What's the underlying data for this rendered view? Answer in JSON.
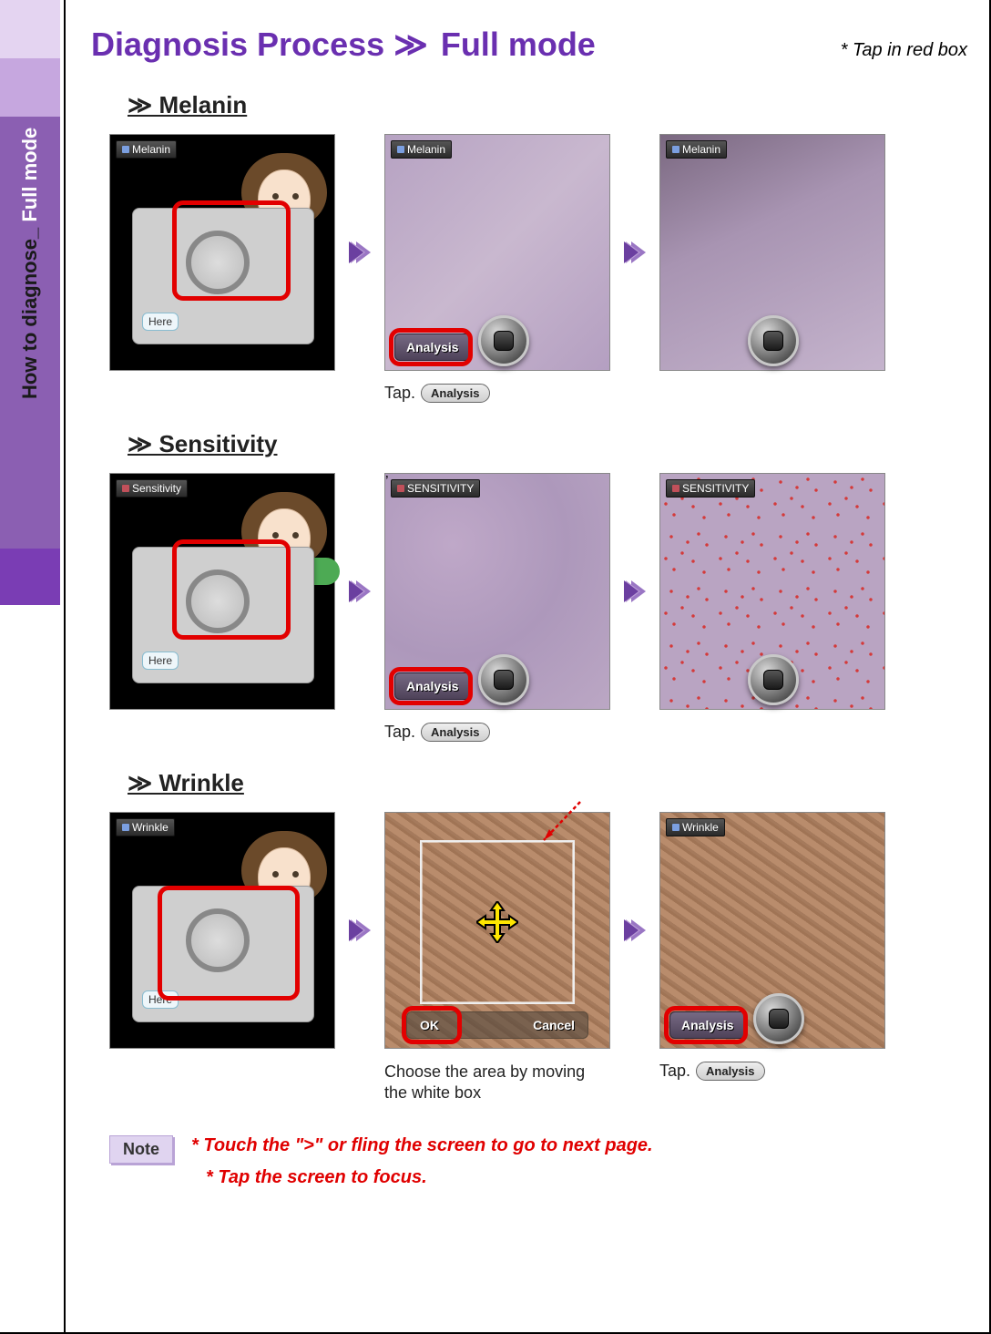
{
  "sidebar": {
    "label_prefix": "How to diagnose_ ",
    "label_suffix": "Full mode"
  },
  "header": {
    "title_a": "Diagnosis Process ",
    "title_sep": "≫",
    "title_b": " Full mode",
    "hint": "* Tap in red box"
  },
  "sections": {
    "melanin": {
      "heading": "≫  Melanin",
      "badge": "Melanin",
      "here": "Here",
      "analysis_btn": "Analysis",
      "tap_label": "Tap.",
      "tap_button": "Analysis"
    },
    "sensitivity": {
      "heading": "≫  Sensitivity",
      "badge1": "Sensitivity",
      "badge2": "SENSITIVITY",
      "here": "Here",
      "analysis_btn": "Analysis",
      "tap_label": "Tap.",
      "tap_button": "Analysis"
    },
    "wrinkle": {
      "heading": "≫  Wrinkle",
      "badge": "Wrinkle",
      "here": "Here",
      "ok": "OK",
      "cancel": "Cancel",
      "analysis_btn": "Analysis",
      "choose_caption": "Choose the area by moving the white box",
      "tap_label": "Tap.",
      "tap_button": "Analysis"
    }
  },
  "notes": {
    "label": "Note",
    "line1": "* Touch the \">\" or fling the screen to go to next page.",
    "line2": "* Tap the screen to focus."
  }
}
